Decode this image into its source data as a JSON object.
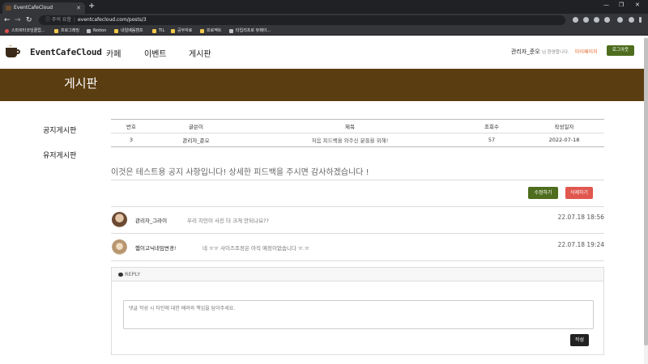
{
  "browser": {
    "tab_title": "EventCafeCloud",
    "url_warning": "주의 요함",
    "url": "eventcafecloud.com/posts/3",
    "bookmarks": [
      "스파르타코딩클럽...",
      "프로그래밍",
      "Notion",
      "내일배움캠프",
      "TIL",
      "공부자료",
      "프로젝트",
      "타입리프로 뷰페이..."
    ]
  },
  "header": {
    "logo_text": "EventCafeCloud",
    "nav": [
      "카페",
      "이벤트",
      "게시판"
    ],
    "greeting_name": "관리자_준오",
    "greeting_suffix": "님 환영합니다.",
    "mypage_label": "마이페이지",
    "logout_label": "로그아웃"
  },
  "banner": {
    "title": "게시판"
  },
  "sidebar": {
    "items": [
      "공지게시판",
      "유저게시판"
    ]
  },
  "post_table": {
    "headers": [
      "번호",
      "글쓴이",
      "제목",
      "조회수",
      "작성일자"
    ],
    "row": [
      "3",
      "관리자_준오",
      "처음 피드백을 와주신 분들을 위해!",
      "57",
      "2022-07-18"
    ]
  },
  "post": {
    "content": "이것은 테스트용 공지 사항입니다! 상세한 피드백을 주시면 감사하겠습니다 !",
    "edit_label": "수정하기",
    "delete_label": "삭제하기"
  },
  "comments": [
    {
      "author": "관리자_그라이",
      "text": "우리 지민이 사진 더 크게 안되나요??",
      "date": "22.07.18 18:56"
    },
    {
      "author": "햄이고닉네임변경!",
      "text": "네 ㅠㅠ 사이즈조정은 아직 예정이없습니다 ㅠ.ㅠ",
      "date": "22.07.18 19:24"
    }
  ],
  "reply": {
    "header_label": "REPLY",
    "placeholder": "댓글 작성 시 타인에 대한 배려와 책임을 담아주세요.",
    "submit_label": "작성"
  },
  "colors": {
    "brand": "#5b3d12",
    "green": "#4e6d1e",
    "red": "#e0574f",
    "accent": "#e5682a"
  }
}
